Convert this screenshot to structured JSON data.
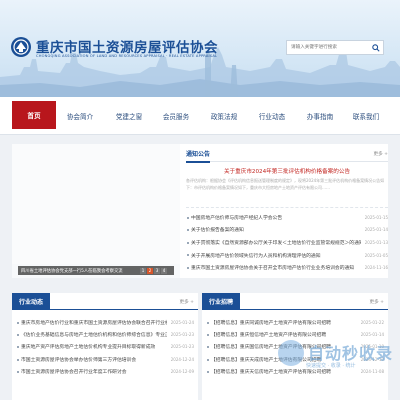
{
  "header": {
    "title": "重庆市国土资源房屋评估协会",
    "subtitle": "CHONGQING ASSOCIATION OF LAND AND RESOURCES APPRAISAL · REAL ESTATE APPRAISAL",
    "search_placeholder": "请输入关键字进行搜索"
  },
  "nav": {
    "items": [
      "首页",
      "协会简介",
      "党建之窗",
      "会员服务",
      "政策法规",
      "行业动态",
      "办事指南",
      "联系我们"
    ],
    "active_index": 0
  },
  "slider": {
    "caption": "四川省土地评估协会党支部一行5人莅临我会考察交流",
    "dots": [
      "1",
      "2",
      "3",
      "4"
    ],
    "active_dot": 1
  },
  "notice": {
    "tab": "通知公告",
    "more": "更多 +",
    "headline": "关于重庆市2024年第三批评估机构价格备案的公告",
    "summary": "各评估机构：根据协会《评估机构信息报送管理制度的规定》，现将2024年第三批评估机构价格备案情况公告如下：市评估机构价格备案情况如下，重庆市大恒房地产土地资产评估有限公司……",
    "items": [
      {
        "title": "中国房地产估价师与房地产经纪人学会公告",
        "date": "2025-01-15"
      },
      {
        "title": "关于估价报告备案的通知",
        "date": "2025-01-14"
      },
      {
        "title": "关于贯彻落实《自然资源部办公厅关于印发＜土地估价行业监管常规规范＞的通知》",
        "date": "2025-01-13"
      },
      {
        "title": "关于开展房地产估价领域失信行为人员和机构清理评估的通知",
        "date": "2025-01-05"
      },
      {
        "title": "重庆市国土资源房屋评估协会关于召开全市房地产估价行业业务培训会的通知",
        "date": "2024-11-16"
      }
    ]
  },
  "industry": {
    "title": "行业动态",
    "more": "更多 +",
    "items": [
      {
        "title": "重庆市房地产估价行业和重庆市国土资源房屋评估协会联合召开行业机构座谈会",
        "date": "2025-01-24"
      },
      {
        "title": "《估价业务基础信息与房地产土地估价机构和估价师综合信息》专业正式发布",
        "date": "2025-01-23"
      },
      {
        "title": "重庆地产资产评估房地产土地估价机构专业提升目标取得新成效",
        "date": "2025-01-23"
      },
      {
        "title": "市国土资源房屋评估协会举办估价师第三方评估培训会",
        "date": "2024-12-24"
      },
      {
        "title": "市国土资源房屋评估协会召开行业年度工作研讨会",
        "date": "2024-12-09"
      }
    ]
  },
  "recruit": {
    "title": "行业招聘",
    "more": "更多 +",
    "items": [
      {
        "title": "【招聘信息】重庆同诚房地产土地资产评估有限公司招聘",
        "date": "2025-01-22"
      },
      {
        "title": "【招聘信息】重庆恒信地产土地资产评估有限公司招聘",
        "date": "2025-01-14"
      },
      {
        "title": "【招聘信息】重庆国信房地产土地资产评估有限公司招聘",
        "date": "2025-01-10"
      },
      {
        "title": "【招聘信息】重庆天成房地产土地评估有限公司招聘",
        "date": "2024-12-10"
      },
      {
        "title": "【招聘信息】重庆天信房地产土地资产评估有限公司招聘",
        "date": "2024-11-08"
      }
    ]
  },
  "watermark": {
    "text": "自动秒收录",
    "sub": "快速提交 · 收录 · 统计"
  },
  "colors": {
    "brand_blue": "#1b4f96",
    "active_red": "#b8161c",
    "headline_red": "#c1221d"
  }
}
